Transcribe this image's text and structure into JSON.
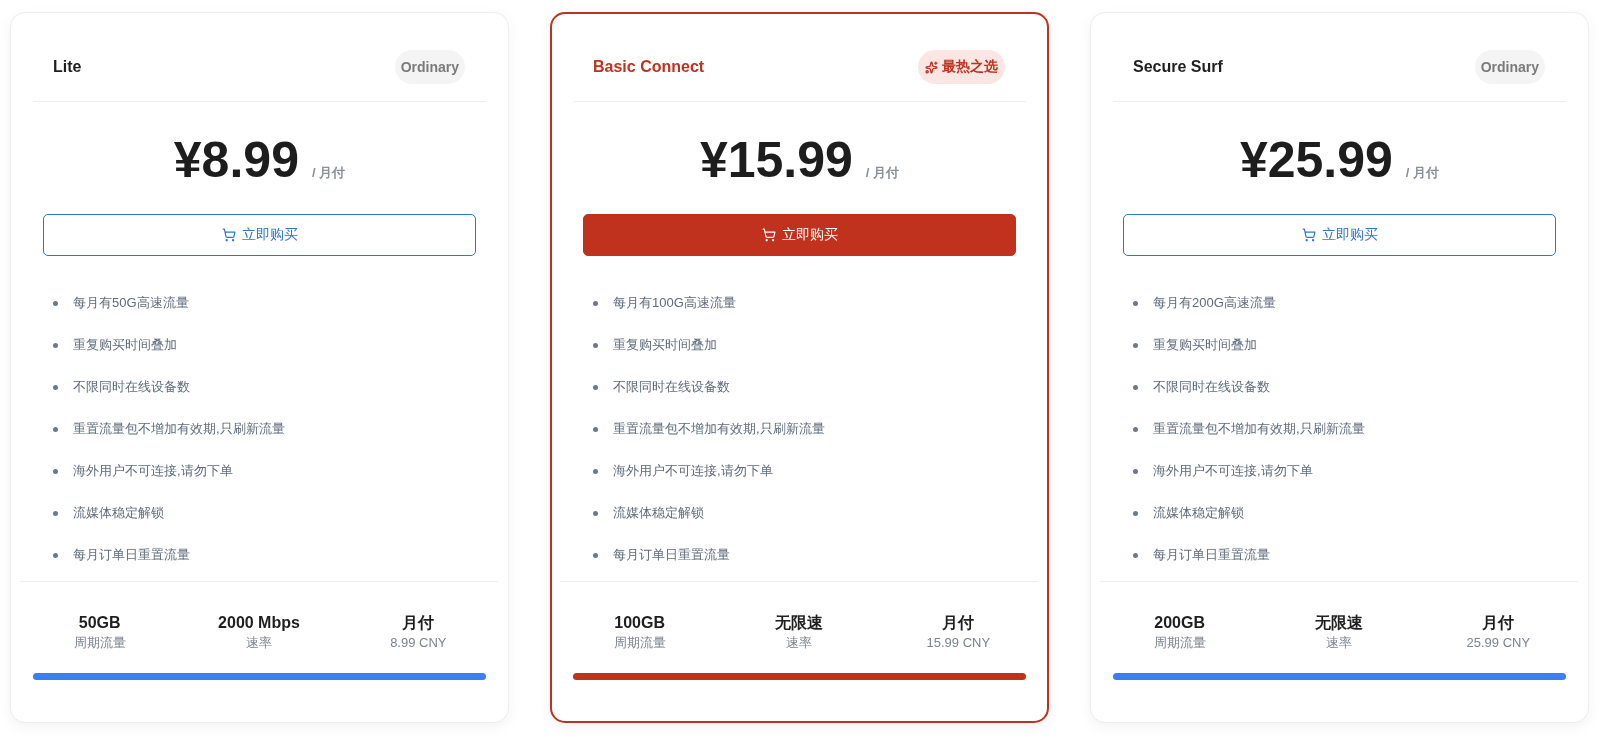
{
  "plans": [
    {
      "name": "Lite",
      "badge": "Ordinary",
      "featured": false,
      "price": "¥8.99",
      "period": "/ 月付",
      "button": "立即购买",
      "features": [
        "每月有50G高速流量",
        "重复购买时间叠加",
        "不限同时在线设备数",
        "重置流量包不增加有效期,只刷新流量",
        "海外用户不可连接,请勿下单",
        "流媒体稳定解锁",
        "每月订单日重置流量"
      ],
      "stats": [
        {
          "value": "50GB",
          "label": "周期流量"
        },
        {
          "value": "2000 Mbps",
          "label": "速率"
        },
        {
          "value": "月付",
          "label": "8.99 CNY"
        }
      ]
    },
    {
      "name": "Basic Connect",
      "badge": "最热之选",
      "featured": true,
      "price": "¥15.99",
      "period": "/ 月付",
      "button": "立即购买",
      "features": [
        "每月有100G高速流量",
        "重复购买时间叠加",
        "不限同时在线设备数",
        "重置流量包不增加有效期,只刷新流量",
        "海外用户不可连接,请勿下单",
        "流媒体稳定解锁",
        "每月订单日重置流量"
      ],
      "stats": [
        {
          "value": "100GB",
          "label": "周期流量"
        },
        {
          "value": "无限速",
          "label": "速率"
        },
        {
          "value": "月付",
          "label": "15.99 CNY"
        }
      ]
    },
    {
      "name": "Secure Surf",
      "badge": "Ordinary",
      "featured": false,
      "price": "¥25.99",
      "period": "/ 月付",
      "button": "立即购买",
      "features": [
        "每月有200G高速流量",
        "重复购买时间叠加",
        "不限同时在线设备数",
        "重置流量包不增加有效期,只刷新流量",
        "海外用户不可连接,请勿下单",
        "流媒体稳定解锁",
        "每月订单日重置流量"
      ],
      "stats": [
        {
          "value": "200GB",
          "label": "周期流量"
        },
        {
          "value": "无限速",
          "label": "速率"
        },
        {
          "value": "月付",
          "label": "25.99 CNY"
        }
      ]
    }
  ]
}
